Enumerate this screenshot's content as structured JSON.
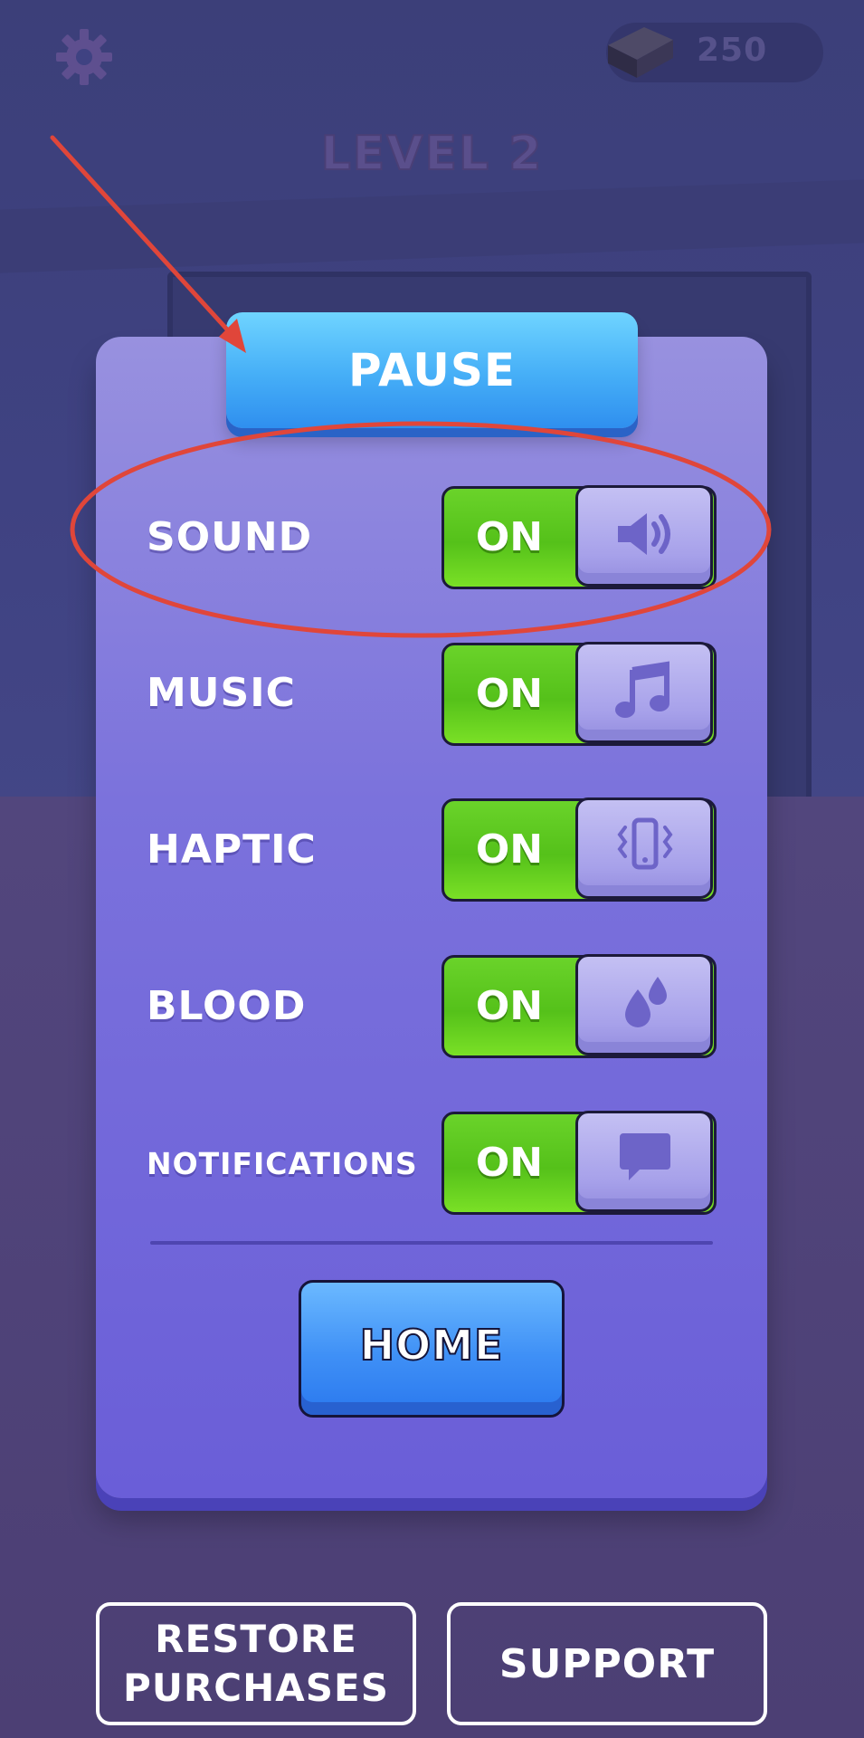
{
  "hud": {
    "currency_amount": "250",
    "level_title": "LEVEL 2",
    "settings_icon": "gear-icon",
    "currency_icon": "brick-icon"
  },
  "panel": {
    "title": "PAUSE",
    "toggles": [
      {
        "label": "SOUND",
        "state": "ON",
        "icon": "speaker-icon"
      },
      {
        "label": "MUSIC",
        "state": "ON",
        "icon": "music-note-icon"
      },
      {
        "label": "HAPTIC",
        "state": "ON",
        "icon": "vibrate-phone-icon"
      },
      {
        "label": "BLOOD",
        "state": "ON",
        "icon": "blood-drops-icon"
      },
      {
        "label": "NOTIFICATIONS",
        "state": "ON",
        "icon": "chat-bubble-icon"
      }
    ],
    "home_label": "HOME"
  },
  "footer": {
    "restore_line1": "RESTORE",
    "restore_line2": "PURCHASES",
    "support_label": "SUPPORT"
  },
  "colors": {
    "toggle_on": "#5cc51f",
    "panel": "#7b72dc",
    "pause_banner": "#45aef7",
    "annotation": "#e0463a"
  }
}
